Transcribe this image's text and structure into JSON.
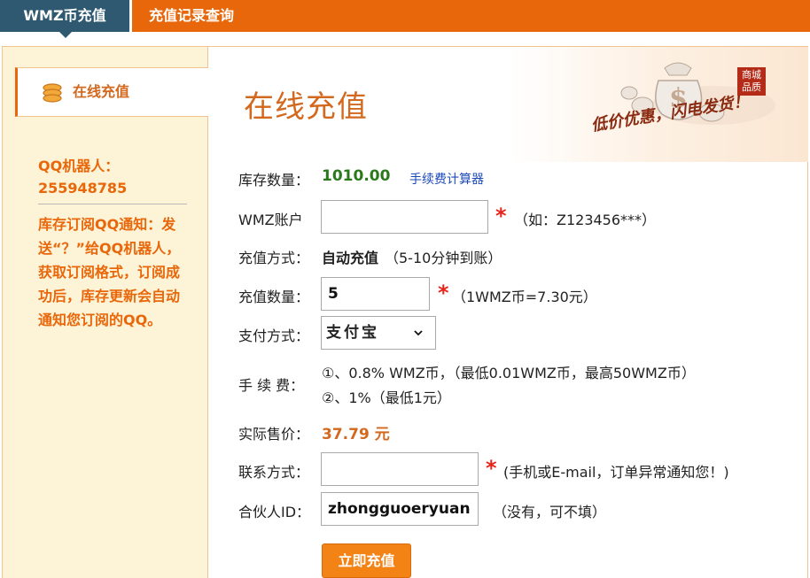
{
  "nav": {
    "active_tab": "WMZ币充值",
    "other_tab": "充值记录查询"
  },
  "sidebar": {
    "item_label": "在线充值",
    "qq_robot": "QQ机器人：255948785",
    "notice": "库存订阅QQ通知：发送“？”给QQ机器人，获取订阅格式，订阅成功后，库存更新会自动通知您订阅的QQ。"
  },
  "banner": {
    "title": "在线充值",
    "promo": "低价优惠，闪电发货！",
    "stamp": "商城品质"
  },
  "form": {
    "stock_label": "库存数量：",
    "stock_value": "1010.00",
    "calc_link": "手续费计算器",
    "account_label": "WMZ账户",
    "account_value": "",
    "account_hint": "（如：Z123456***）",
    "method_label": "充值方式：",
    "method_value": "自动充值",
    "method_note": "（5-10分钟到账）",
    "qty_label": "充值数量：",
    "qty_value": "5",
    "qty_hint": "（1WMZ币=7.30元）",
    "pay_label": "支付方式：",
    "pay_value": "支付宝",
    "fee_label": "手 续 费：",
    "fee_line1": "①、0.8% WMZ币，（最低0.01WMZ币，最高50WMZ币）",
    "fee_line2": "②、1%（最低1元）",
    "price_label": "实际售价：",
    "price_value": "37.79 元",
    "contact_label": "联系方式：",
    "contact_value": "",
    "contact_hint": "(手机或E-mail，订单异常通知您！)",
    "partner_label": "合伙人ID：",
    "partner_value": "zhongguoeryuan",
    "partner_hint": "（没有，可不填）",
    "submit_label": "立即充值",
    "required_mark": "*"
  },
  "colors": {
    "nav_orange": "#e8670b",
    "nav_active": "#2f5970",
    "sidebar_bg": "#fdf3d6",
    "accent_text": "#d2691e",
    "stock_green": "#2a7a1c",
    "required_red": "#e8231a",
    "button_orange": "#f48316"
  }
}
